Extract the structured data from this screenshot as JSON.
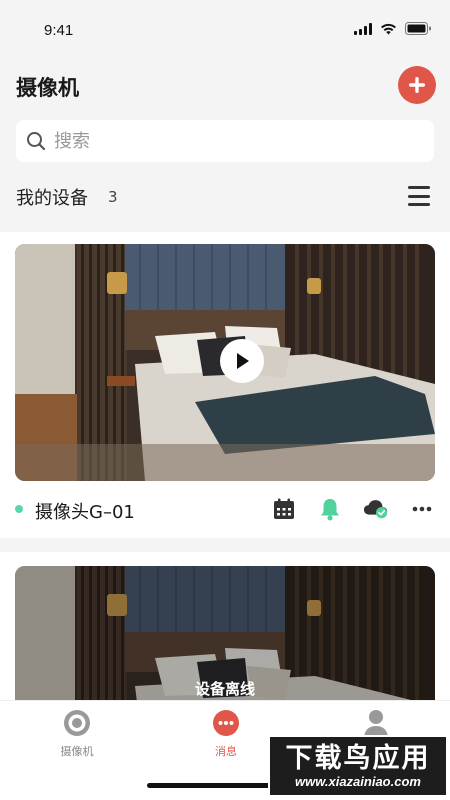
{
  "status_bar": {
    "time": "9:41"
  },
  "header": {
    "title": "摄像机"
  },
  "search": {
    "placeholder": "搜索"
  },
  "devices": {
    "title": "我的设备",
    "count": "3"
  },
  "cameras": [
    {
      "name": "摄像头G–01",
      "status": "online"
    },
    {
      "offline_label": "设备离线"
    }
  ],
  "tabs": [
    {
      "label": "摄像机"
    },
    {
      "label": "消息"
    },
    {
      "label": ""
    }
  ],
  "watermark": {
    "main": "下载鸟应用",
    "sub": "www.xiazainiao.com"
  },
  "colors": {
    "accent": "#e0574a",
    "online": "#5bd6a8",
    "bell": "#4fd39a"
  }
}
